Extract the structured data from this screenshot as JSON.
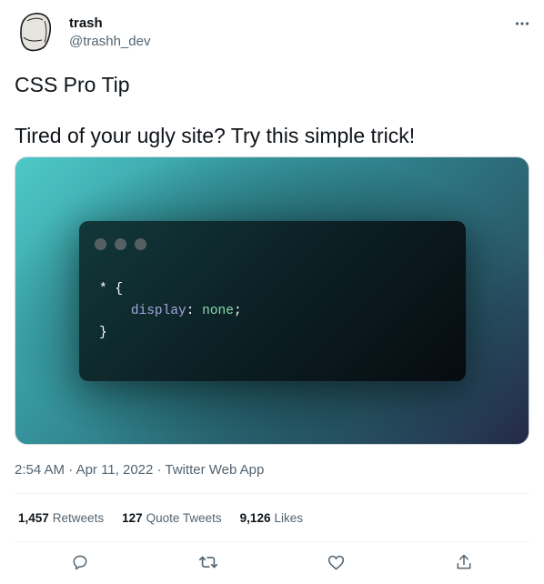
{
  "author": {
    "display_name": "trash",
    "handle": "@trashh_dev"
  },
  "tweet": {
    "line1": "CSS Pro Tip",
    "line2": "Tired of your ugly site? Try this simple trick!"
  },
  "code": {
    "selector_open": "* {",
    "property": "display",
    "colon": ": ",
    "value": "none",
    "semicolon": ";",
    "close": "}"
  },
  "meta": {
    "time": "2:54 AM",
    "separator": " · ",
    "date": "Apr 11, 2022",
    "source": "Twitter Web App"
  },
  "stats": {
    "retweets_count": "1,457",
    "retweets_label": "Retweets",
    "quotes_count": "127",
    "quotes_label": "Quote Tweets",
    "likes_count": "9,126",
    "likes_label": "Likes"
  },
  "icons": {
    "more": "more-horizontal-icon",
    "reply": "reply-icon",
    "retweet": "retweet-icon",
    "like": "heart-icon",
    "share": "share-icon"
  },
  "colors": {
    "text_primary": "#0f1419",
    "text_secondary": "#536471",
    "divider": "#eff3f4",
    "code_property": "#a4a7de",
    "code_value": "#89d9b0"
  }
}
